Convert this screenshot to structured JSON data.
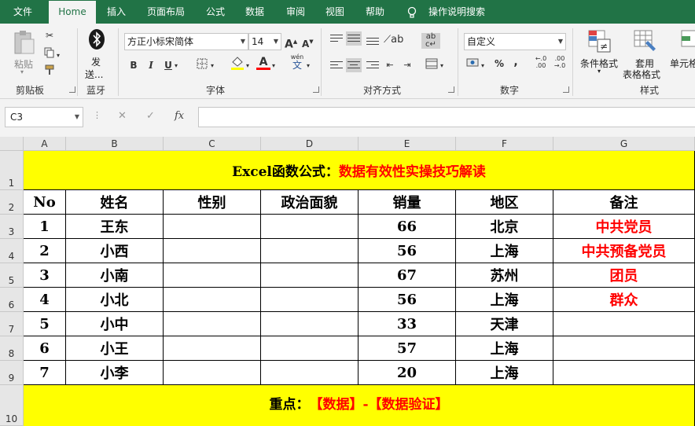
{
  "menu": {
    "tabs": [
      "文件",
      "Home",
      "插入",
      "页面布局",
      "公式",
      "数据",
      "审阅",
      "视图",
      "帮助"
    ],
    "search_label": "操作说明搜索"
  },
  "ribbon": {
    "clipboard": {
      "paste": "粘贴",
      "label": "剪贴板"
    },
    "bluetooth": {
      "send_line1": "发",
      "send_line2": "送...",
      "label": "蓝牙"
    },
    "font": {
      "font_name": "方正小标宋简体",
      "font_size": "14",
      "bold": "B",
      "italic": "I",
      "underline": "U",
      "grow": "A",
      "shrink": "A",
      "font_color_letter": "A",
      "wen": "wén",
      "wen_char": "文",
      "label": "字体"
    },
    "alignment": {
      "label": "对齐方式"
    },
    "number": {
      "format": "自定义",
      "percent": "%",
      "comma": ",",
      "label": "数字"
    },
    "styles": {
      "conditional": "条件格式",
      "table_line1": "套用",
      "table_line2": "表格格式",
      "cell": "单元格",
      "label": "样式"
    },
    "colors": {
      "accent": "#217346",
      "font_color_bar": "#ff0000",
      "highlight_bar": "#ffff00"
    }
  },
  "formula_bar": {
    "name_box": "C3",
    "fx": "fx",
    "cancel": "✕",
    "enter": "✓",
    "value": ""
  },
  "sheet": {
    "columns": [
      "A",
      "B",
      "C",
      "D",
      "E",
      "F",
      "G"
    ],
    "rows": [
      "1",
      "2",
      "3",
      "4",
      "5",
      "6",
      "7",
      "8",
      "9",
      "10"
    ],
    "title_black": "Excel函数公式：",
    "title_red": "数据有效性实操技巧解读",
    "headers": [
      "No",
      "姓名",
      "性别",
      "政治面貌",
      "销量",
      "地区",
      "备注"
    ],
    "data": [
      [
        "1",
        "王东",
        "",
        "",
        "66",
        "北京",
        "中共党员"
      ],
      [
        "2",
        "小西",
        "",
        "",
        "56",
        "上海",
        "中共预备党员"
      ],
      [
        "3",
        "小南",
        "",
        "",
        "67",
        "苏州",
        "团员"
      ],
      [
        "4",
        "小北",
        "",
        "",
        "56",
        "上海",
        "群众"
      ],
      [
        "5",
        "小中",
        "",
        "",
        "33",
        "天津",
        ""
      ],
      [
        "6",
        "小王",
        "",
        "",
        "57",
        "上海",
        ""
      ],
      [
        "7",
        "小李",
        "",
        "",
        "20",
        "上海",
        ""
      ]
    ],
    "footer_black": "重点：",
    "footer_red": "【数据】-【数据验证】",
    "fill_color": "#ffff00",
    "remark_color": "#ff0000"
  }
}
